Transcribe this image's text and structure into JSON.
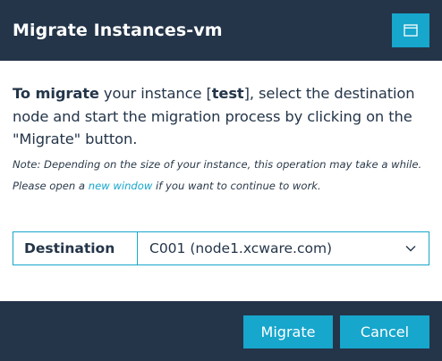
{
  "dialog": {
    "title": "Migrate Instances-vm",
    "maximize_icon": "window-maximize-icon"
  },
  "content": {
    "intro_bold": "To migrate",
    "intro_1": " your instance [",
    "instance_name": "test",
    "intro_2": "], select the destination node and start the migration process by clicking on the \"Migrate\" button.",
    "note_1": "Note: Depending on the size of your instance, this operation may take a while. Please open a ",
    "note_link": "new window",
    "note_2": " if you want to continue to work."
  },
  "destination": {
    "label": "Destination",
    "selected": "C001 (node1.xcware.com)",
    "dropdown_icon": "chevron-down-icon"
  },
  "footer": {
    "migrate_label": "Migrate",
    "cancel_label": "Cancel"
  },
  "colors": {
    "header_bg": "#243549",
    "accent": "#17a6cc",
    "text": "#243549",
    "body_bg": "#ffffff"
  }
}
